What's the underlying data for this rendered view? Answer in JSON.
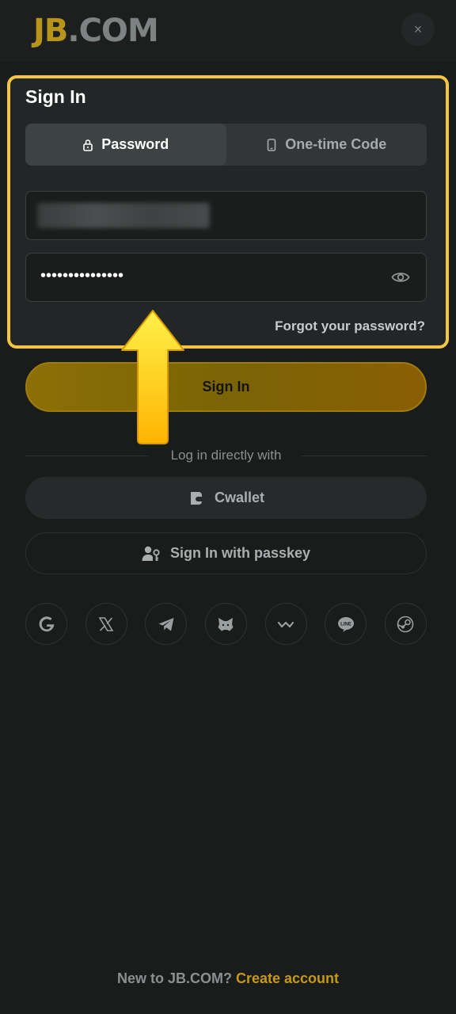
{
  "header": {
    "logo_jb": "JB",
    "logo_dot": ".",
    "logo_com": "COM",
    "close_label": "×"
  },
  "signin_form": {
    "title": "Sign In",
    "tabs": [
      {
        "label": "Password",
        "icon": "lock-icon",
        "active": true
      },
      {
        "label": "One-time Code",
        "icon": "phone-icon",
        "active": false
      }
    ],
    "password_value": "•••••••••••••••",
    "forgot_label": "Forgot your password?"
  },
  "signin_button": {
    "label": "Sign In"
  },
  "alt_login": {
    "divider_text": "Log in directly with",
    "cwallet_label": "Cwallet",
    "passkey_label": "Sign In with passkey",
    "socials": [
      "google-icon",
      "x-icon",
      "telegram-icon",
      "metamask-icon",
      "walletconnect-icon",
      "line-icon",
      "steam-icon"
    ]
  },
  "footer": {
    "prompt": "New to JB.COM?",
    "link": "Create account"
  },
  "colors": {
    "accent": "#f5c542",
    "brand_gold": "#b8951a",
    "background": "#1a1c1c"
  }
}
